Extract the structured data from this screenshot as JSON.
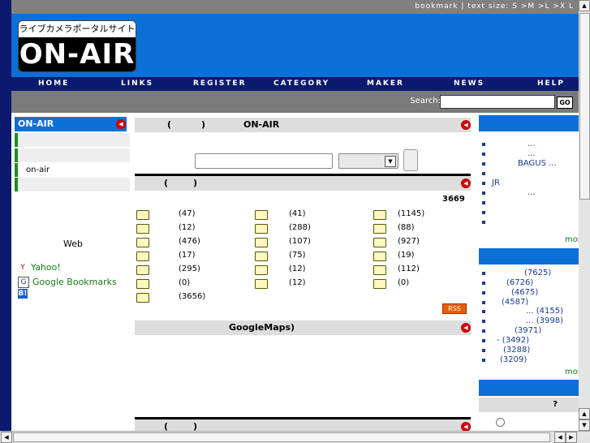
{
  "topbar": {
    "text": "bookmark | text size: S >M >L >X L"
  },
  "logo": {
    "subtitle": "ライブカメラポータルサイト",
    "main": "ON-AIR"
  },
  "nav": [
    "HOME",
    "LINKS",
    "REGISTER",
    "CATEGORY",
    "MAKER",
    "NEWS",
    "HELP"
  ],
  "search": {
    "label": "Search:",
    "value": "",
    "go": "GO"
  },
  "left": {
    "header": "ON-AIR",
    "rows": [
      "",
      "",
      "on-air",
      ""
    ],
    "web_label": "Web",
    "links": [
      {
        "icon": "yahoo-icon",
        "label": "Yahoo!"
      },
      {
        "icon": "google-icon",
        "label": "Google Bookmarks"
      },
      {
        "icon": "hatena-icon",
        "label": "B!"
      }
    ]
  },
  "center": {
    "bar1": {
      "left": "(",
      "right": ")",
      "title": "ON-AIR"
    },
    "keyword": {
      "value": "",
      "select": ""
    },
    "bar2": {
      "left": "(",
      "right": ")"
    },
    "total": "3669",
    "categories": [
      [
        "(47)",
        "(41)",
        "(1145)"
      ],
      [
        "(12)",
        "(288)",
        "(88)"
      ],
      [
        "(476)",
        "(107)",
        "(927)"
      ],
      [
        "(17)",
        "(75)",
        "(19)"
      ],
      [
        "(295)",
        "(12)",
        "(112)"
      ],
      [
        "(0)",
        "(12)",
        "(0)"
      ],
      [
        "(3656)"
      ]
    ],
    "rss": "RSS",
    "bar3": {
      "title": "GoogleMaps)"
    },
    "bar4": {
      "left": "(",
      "right": ")"
    }
  },
  "right": {
    "list1": [
      "...",
      "...",
      "BAGUS ...",
      "",
      "JR",
      "...",
      "",
      "",
      ""
    ],
    "more1": "mor",
    "list2": [
      "(7625)",
      "(6726)",
      "(4675)",
      "(4587)",
      "... (4155)",
      "... (3998)",
      "(3971)",
      "- (3492)",
      "(3288)",
      "(3209)"
    ],
    "more2": "mor",
    "q_label": "?"
  }
}
